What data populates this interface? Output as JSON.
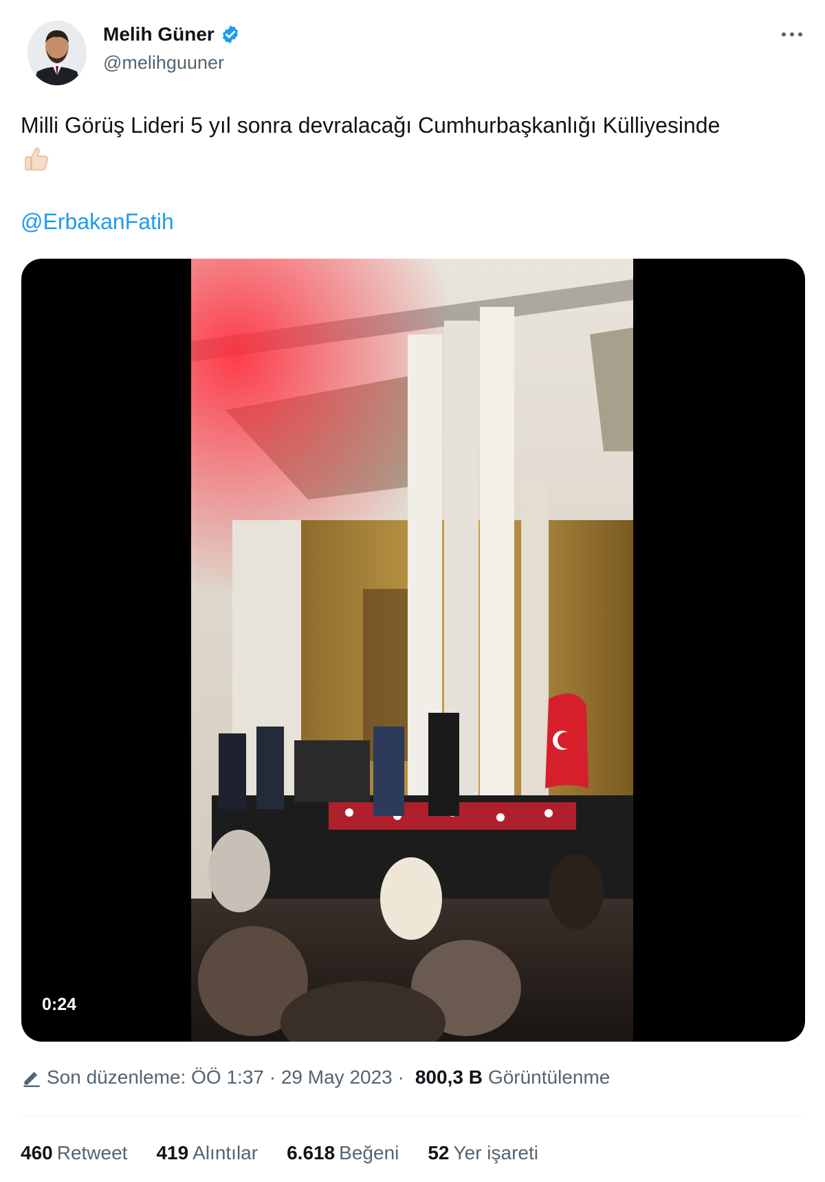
{
  "author": {
    "name": "Melih Güner",
    "handle": "@melihguuner",
    "avatar_icon": "user-avatar",
    "verified_icon": "verified-badge-icon"
  },
  "tweet": {
    "text": "Milli Görüş Lideri 5 yıl sonra devralacağı Cumhurbaşkanlığı Külliyesinde",
    "emoji_icon": "thumbs-up-icon",
    "mention": "@ErbakanFatih"
  },
  "media": {
    "duration": "0:24"
  },
  "meta": {
    "edited_label": "Son düzenleme: ÖÖ 1:37 · 29 May 2023 ·",
    "views_value": "800,3 B",
    "views_label": "Görüntülenme"
  },
  "stats": [
    {
      "value": "460",
      "label": "Retweet"
    },
    {
      "value": "419",
      "label": "Alıntılar"
    },
    {
      "value": "6.618",
      "label": "Beğeni"
    },
    {
      "value": "52",
      "label": "Yer işareti"
    }
  ],
  "colors": {
    "link": "#1d9bf0",
    "secondary_text": "#536471",
    "primary_text": "#0f1419"
  }
}
